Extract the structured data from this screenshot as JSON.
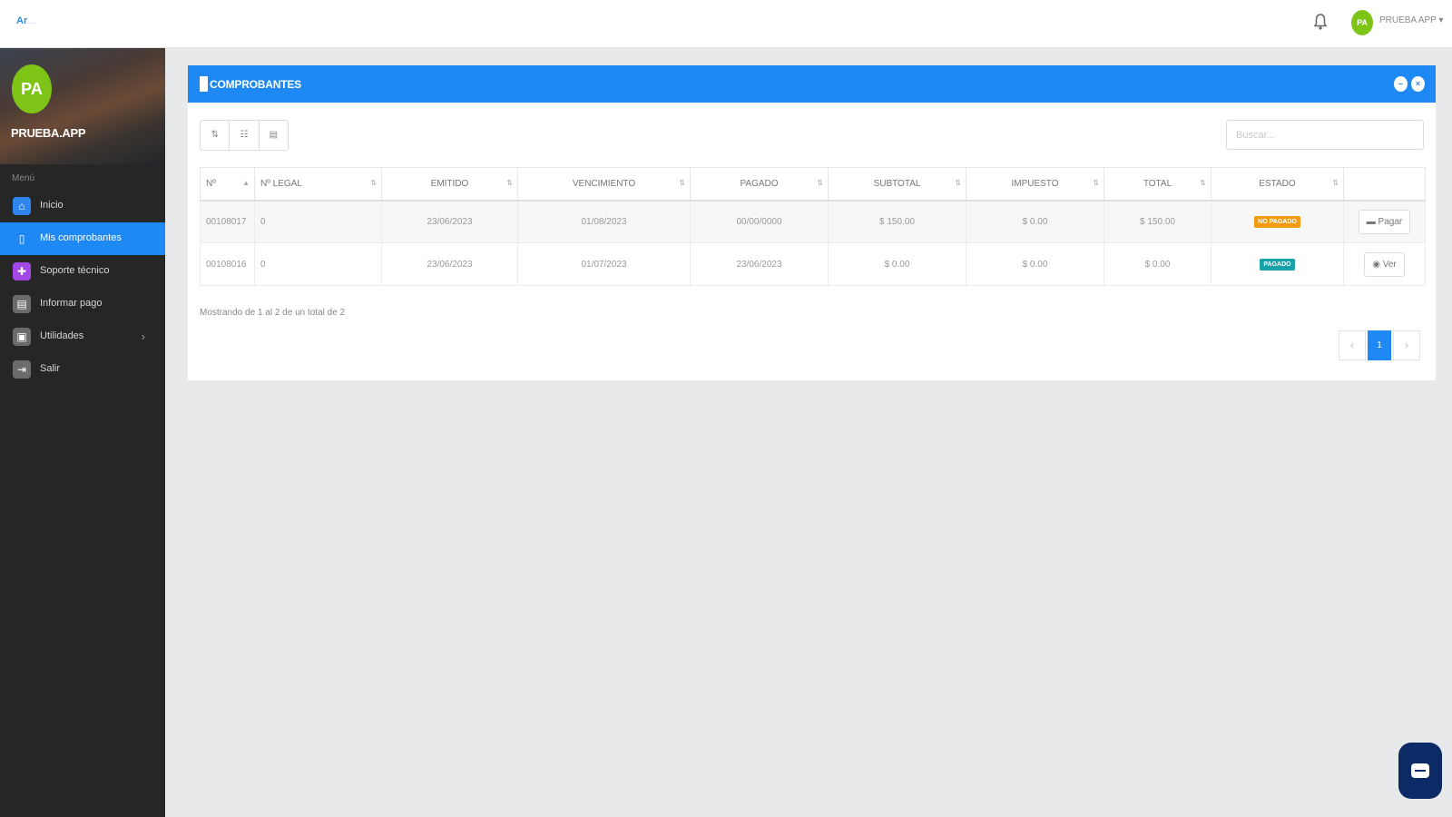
{
  "topbar": {
    "logo_text": "Ar",
    "logo_faint": "...",
    "bell_icon": "bell-icon",
    "user_initials": "PA",
    "user_name": "PRUEBA APP ▾"
  },
  "sidebar": {
    "avatar_initials": "PA",
    "user_name": "PRUEBA.APP",
    "menu_label": "Menú",
    "items": [
      {
        "label": "Inicio",
        "icon": "⌂",
        "icon_name": "home-icon",
        "icon_color": "#2f86f0",
        "active": false
      },
      {
        "label": "Mis comprobantes",
        "icon": "▯",
        "icon_name": "document-icon",
        "icon_color": "#1e88f5",
        "active": true
      },
      {
        "label": "Soporte técnico",
        "icon": "✚",
        "icon_name": "support-icon",
        "icon_color": "#a347e6",
        "active": false
      },
      {
        "label": "Informar pago",
        "icon": "▤",
        "icon_name": "receipt-icon",
        "icon_color": "#6b6b6b",
        "active": false
      },
      {
        "label": "Utilidades",
        "icon": "▣",
        "icon_name": "toolbox-icon",
        "icon_color": "#6b6b6b",
        "active": false,
        "has_submenu": true
      },
      {
        "label": "Salir",
        "icon": "⇥",
        "icon_name": "logout-icon",
        "icon_color": "#6b6b6b",
        "active": false
      }
    ]
  },
  "card": {
    "title": "COMPROBANTES",
    "header_buttons": [
      "minimize-icon",
      "close-icon"
    ]
  },
  "toolbar": {
    "buttons": [
      "⇅",
      "☷",
      "▤"
    ]
  },
  "search": {
    "placeholder": "Buscar..."
  },
  "table": {
    "columns": [
      "Nº",
      "Nº LEGAL",
      "EMITIDO",
      "VENCIMIENTO",
      "PAGADO",
      "SUBTOTAL",
      "IMPUESTO",
      "TOTAL",
      "ESTADO",
      ""
    ],
    "rows": [
      {
        "numero": "00108017",
        "legal": "0",
        "emitido": "23/06/2023",
        "vencimiento": "01/08/2023",
        "pagado": "00/00/0000",
        "subtotal": "$ 150.00",
        "impuesto": "$ 0.00",
        "total": "$ 150.00",
        "estado": "NO PAGADO",
        "estado_color": "#f39c12",
        "action": "▬ Pagar"
      },
      {
        "numero": "00108016",
        "legal": "0",
        "emitido": "23/06/2023",
        "vencimiento": "01/07/2023",
        "pagado": "23/06/2023",
        "subtotal": "$ 0.00",
        "impuesto": "$ 0.00",
        "total": "$ 0.00",
        "estado": "PAGADO",
        "estado_color": "#17a2a8",
        "action": "◉ Ver"
      }
    ]
  },
  "footer": {
    "info": "Mostrando de 1 al 2 de un total de 2",
    "pager_prev": "‹",
    "pager_current": "1",
    "pager_next": "›"
  },
  "colors": {
    "primary": "#1e88f5",
    "sidebar_bg": "#262626",
    "avatar": "#7ec417",
    "chat": "#0c2a66"
  }
}
